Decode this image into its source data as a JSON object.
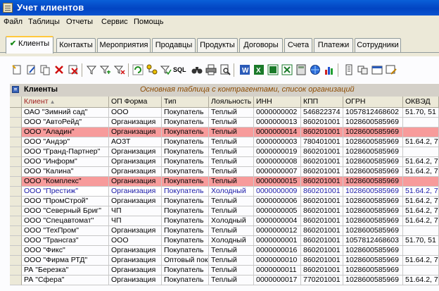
{
  "window": {
    "title": "Учет клиентов"
  },
  "menu": [
    "Файл",
    "Таблицы",
    "Отчеты",
    "Сервис",
    "Помощь"
  ],
  "tabs": [
    {
      "label": "Клиенты",
      "active": true
    },
    {
      "label": "Контакты"
    },
    {
      "label": "Мероприятия"
    },
    {
      "label": "Продавцы"
    },
    {
      "label": "Продукты"
    },
    {
      "label": "Договоры"
    },
    {
      "label": "Счета"
    },
    {
      "label": "Платежи"
    },
    {
      "label": "Сотрудники"
    }
  ],
  "toolbar": [
    "new-record-icon",
    "edit-icon",
    "copy-icon",
    "delete-icon",
    "delete-all-icon",
    "filter-icon",
    "filter-add-icon",
    "filter-clear-icon",
    "refresh-icon",
    "tree-icon",
    "check-filter-icon",
    "sql-icon",
    "binoculars-icon",
    "print-icon",
    "print-preview-icon",
    "word-icon",
    "excel-icon",
    "word-export-icon",
    "excel-export-icon",
    "calc-icon",
    "web-icon",
    "chart-icon",
    "properties-icon",
    "columns-icon",
    "settings-icon",
    "form-icon"
  ],
  "grid": {
    "title": "Клиенты",
    "description": "Основная таблица с контрагентами, список организаций",
    "columns": [
      "Клиент",
      "ОП Форма",
      "Тип",
      "Лояльность",
      "ИНН",
      "КПП",
      "ОГРН",
      "ОКВЭД"
    ],
    "rows": [
      {
        "status": "normal",
        "cells": [
          "ОАО \"Зимний сад\"",
          "ООО",
          "Покупатель",
          "Теплый",
          "0000000002",
          "546822374",
          "1057812468602",
          "51.70, 51"
        ]
      },
      {
        "status": "normal",
        "cells": [
          "ООО \"АвтоРейд\"",
          "Организация",
          "Покупатель",
          "Теплый",
          "0000000013",
          "860201001",
          "1028600585969",
          ""
        ]
      },
      {
        "status": "red",
        "cells": [
          "ООО \"Аладин\"",
          "Организация",
          "Покупатель",
          "Теплый",
          "0000000014",
          "860201001",
          "1028600585969",
          ""
        ]
      },
      {
        "status": "normal",
        "cells": [
          "ООО \"Андэр\"",
          "АОЗТ",
          "Покупатель",
          "Теплый",
          "0000000003",
          "780401001",
          "1028600585969",
          "51.64.2, 7"
        ]
      },
      {
        "status": "normal",
        "cells": [
          "ООО \"Гранд-Партнер\"",
          "Организация",
          "Покупатель",
          "Теплый",
          "0000000019",
          "860201001",
          "1028600585969",
          ""
        ]
      },
      {
        "status": "normal",
        "cells": [
          "ООО \"Информ\"",
          "Организация",
          "Покупатель",
          "Теплый",
          "0000000008",
          "860201001",
          "1028600585969",
          "51.64.2, 7"
        ]
      },
      {
        "status": "normal",
        "cells": [
          "ООО \"Калина\"",
          "Организация",
          "Покупатель",
          "Теплый",
          "0000000007",
          "860201001",
          "1028600585969",
          "51.64.2, 7"
        ]
      },
      {
        "status": "red",
        "cells": [
          "ООО \"Комплекс\"",
          "Организация",
          "Покупатель",
          "Теплый",
          "0000000015",
          "860201001",
          "1028600585969",
          ""
        ]
      },
      {
        "status": "blue",
        "cells": [
          "ООО \"Престиж\"",
          "Организация",
          "Покупатель",
          "Холодный",
          "0000000009",
          "860201001",
          "1028600585969",
          "51.64.2, 7"
        ]
      },
      {
        "status": "normal",
        "cells": [
          "ООО \"ПромСтрой\"",
          "Организация",
          "Покупатель",
          "Теплый",
          "0000000006",
          "860201001",
          "1028600585969",
          "51.64.2, 7"
        ]
      },
      {
        "status": "normal",
        "cells": [
          "ООО \"Северный Бриг\"",
          "ЧП",
          "Покупатель",
          "Теплый",
          "0000000005",
          "860201001",
          "1028600585969",
          "51.64.2, 7"
        ]
      },
      {
        "status": "normal",
        "cells": [
          "ООО \"Спецавтомат\"",
          "ЧП",
          "Покупатель",
          "Холодный",
          "0000000004",
          "860201001",
          "1028600585969",
          "51.64.2, 7"
        ]
      },
      {
        "status": "normal",
        "cells": [
          "ООО \"ТехПром\"",
          "Организация",
          "Покупатель",
          "Теплый",
          "0000000012",
          "860201001",
          "1028600585969",
          ""
        ]
      },
      {
        "status": "normal",
        "cells": [
          "ООО \"Трансгаз\"",
          "ООО",
          "Покупатель",
          "Холодный",
          "0000000001",
          "860201001",
          "1057812468603",
          "51.70, 51"
        ]
      },
      {
        "status": "normal",
        "cells": [
          "ООО \"Фикс\"",
          "Организация",
          "Покупатель",
          "Теплый",
          "0000000016",
          "860201001",
          "1028600585969",
          ""
        ]
      },
      {
        "status": "normal",
        "cells": [
          "ООО \"Фирма РТД\"",
          "Организация",
          "Оптовый пок",
          "Теплый",
          "0000000010",
          "860201001",
          "1028600585969",
          "51.64.2, 7"
        ]
      },
      {
        "status": "normal",
        "cells": [
          "РА \"Березка\"",
          "Организация",
          "Покупатель",
          "Теплый",
          "0000000011",
          "860201001",
          "1028600585969",
          ""
        ]
      },
      {
        "status": "normal",
        "cells": [
          "РА \"Сфера\"",
          "Организация",
          "Покупатель",
          "Теплый",
          "0000000017",
          "770201001",
          "1028600585969",
          "51.64.2, 7"
        ]
      }
    ]
  }
}
